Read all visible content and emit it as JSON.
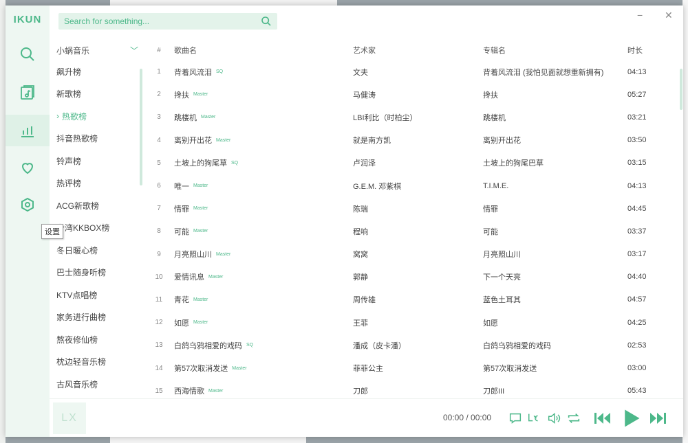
{
  "app": {
    "logo": "IKUN"
  },
  "search": {
    "placeholder": "Search for something..."
  },
  "window": {
    "minimize": "−",
    "close": "✕"
  },
  "tooltip": "设置",
  "source_list": {
    "selected": "小蜗音乐",
    "items": [
      "飙升榜",
      "新歌榜",
      "热歌榜",
      "抖音热歌榜",
      "铃声榜",
      "热评榜",
      "ACG新歌榜",
      "台湾KKBOX榜",
      "冬日暖心榜",
      "巴士随身听榜",
      "KTV点唱榜",
      "家务进行曲榜",
      "熬夜修仙榜",
      "枕边轻音乐榜",
      "古风音乐榜"
    ],
    "active_index": 2
  },
  "table": {
    "headers": {
      "num": "#",
      "name": "歌曲名",
      "artist": "艺术家",
      "album": "专辑名",
      "time": "时长"
    },
    "rows": [
      {
        "num": "1",
        "name": "背着风流泪",
        "tag": "SQ",
        "artist": "文夫",
        "album": "背着风流泪 (我怕见面就想重新拥有)",
        "time": "04:13"
      },
      {
        "num": "2",
        "name": "搀扶",
        "tag": "Master",
        "artist": "马健涛",
        "album": "搀扶",
        "time": "05:27"
      },
      {
        "num": "3",
        "name": "跳楼机",
        "tag": "Master",
        "artist": "LBI利比（时柏尘）",
        "album": "跳楼机",
        "time": "03:21"
      },
      {
        "num": "4",
        "name": "离别开出花",
        "tag": "Master",
        "artist": "就是南方凯",
        "album": "离别开出花",
        "time": "03:50"
      },
      {
        "num": "5",
        "name": "土坡上的狗尾草",
        "tag": "SQ",
        "artist": "卢润泽",
        "album": "土坡上的狗尾巴草",
        "time": "03:15"
      },
      {
        "num": "6",
        "name": "唯一",
        "tag": "Master",
        "artist": "G.E.M. 邓紫棋",
        "album": "T.I.M.E.",
        "time": "04:13"
      },
      {
        "num": "7",
        "name": "情罪",
        "tag": "Master",
        "artist": "陈瑞",
        "album": "情罪",
        "time": "04:45"
      },
      {
        "num": "8",
        "name": "可能",
        "tag": "Master",
        "artist": "程响",
        "album": "可能",
        "time": "03:37"
      },
      {
        "num": "9",
        "name": "月亮照山川",
        "tag": "Master",
        "artist": "窝窝",
        "album": "月亮照山川",
        "time": "03:17"
      },
      {
        "num": "10",
        "name": "爱情讯息",
        "tag": "Master",
        "artist": "郭静",
        "album": "下一个天亮",
        "time": "04:40"
      },
      {
        "num": "11",
        "name": "青花",
        "tag": "Master",
        "artist": "周传雄",
        "album": "蓝色土耳其",
        "time": "04:57"
      },
      {
        "num": "12",
        "name": "如愿",
        "tag": "Master",
        "artist": "王菲",
        "album": "如愿",
        "time": "04:25"
      },
      {
        "num": "13",
        "name": "白鸽乌鸦相爱的戏码",
        "tag": "SQ",
        "artist": "潘成（皮卡潘）",
        "album": "白鸽乌鸦相爱的戏码",
        "time": "02:53"
      },
      {
        "num": "14",
        "name": "第57次取消发送",
        "tag": "Master",
        "artist": "菲菲公主",
        "album": "第57次取消发送",
        "time": "03:00"
      },
      {
        "num": "15",
        "name": "西海情歌",
        "tag": "Master",
        "artist": "刀郎",
        "album": "刀郎III",
        "time": "05:43"
      }
    ]
  },
  "player": {
    "cover_text": "LX",
    "time": "00:00 / 00:00"
  },
  "colors": {
    "accent": "#4db88a",
    "rail_bg": "#eef7f2"
  }
}
